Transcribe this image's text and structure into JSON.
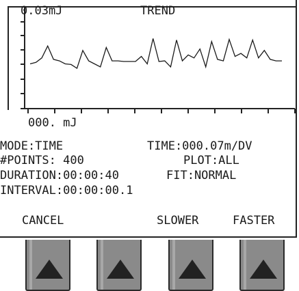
{
  "screen": {
    "y_top_label": "0.03mJ",
    "title": "TREND",
    "y_bottom_label": "000. mJ",
    "mode": "MODE:TIME",
    "time": "TIME:000.07m/DV",
    "points": "#POINTS: 400",
    "plot": "PLOT:ALL",
    "duration": "DURATION:00:00:40",
    "fit": "FIT:NORMAL",
    "interval": "INTERVAL:00:00:00.1"
  },
  "softkeys": {
    "k1": "CANCEL",
    "k2": "",
    "k3": "SLOWER",
    "k4": "FASTER"
  },
  "hardware_buttons": [
    {
      "icon": "up-triangle-icon"
    },
    {
      "icon": "up-triangle-icon"
    },
    {
      "icon": "up-triangle-icon"
    },
    {
      "icon": "up-triangle-icon"
    }
  ],
  "chart_data": {
    "type": "line",
    "title": "TREND",
    "ylabel_top": "0.03mJ",
    "ylabel_bottom": "000. mJ",
    "y_unit": "mJ",
    "ylim": [
      0,
      0.03
    ],
    "series": [
      {
        "values": [
          0.015,
          0.0155,
          0.017,
          0.021,
          0.0165,
          0.016,
          0.015,
          0.0148,
          0.0135,
          0.0195,
          0.016,
          0.015,
          0.014,
          0.0205,
          0.016,
          0.016,
          0.0158,
          0.0158,
          0.0158,
          0.0175,
          0.015,
          0.0235,
          0.0158,
          0.016,
          0.014,
          0.023,
          0.016,
          0.018,
          0.017,
          0.02,
          0.014,
          0.0225,
          0.0165,
          0.016,
          0.0232,
          0.0175,
          0.0185,
          0.017,
          0.023,
          0.017,
          0.0195,
          0.0165,
          0.016,
          0.016
        ]
      }
    ],
    "grid": false
  }
}
